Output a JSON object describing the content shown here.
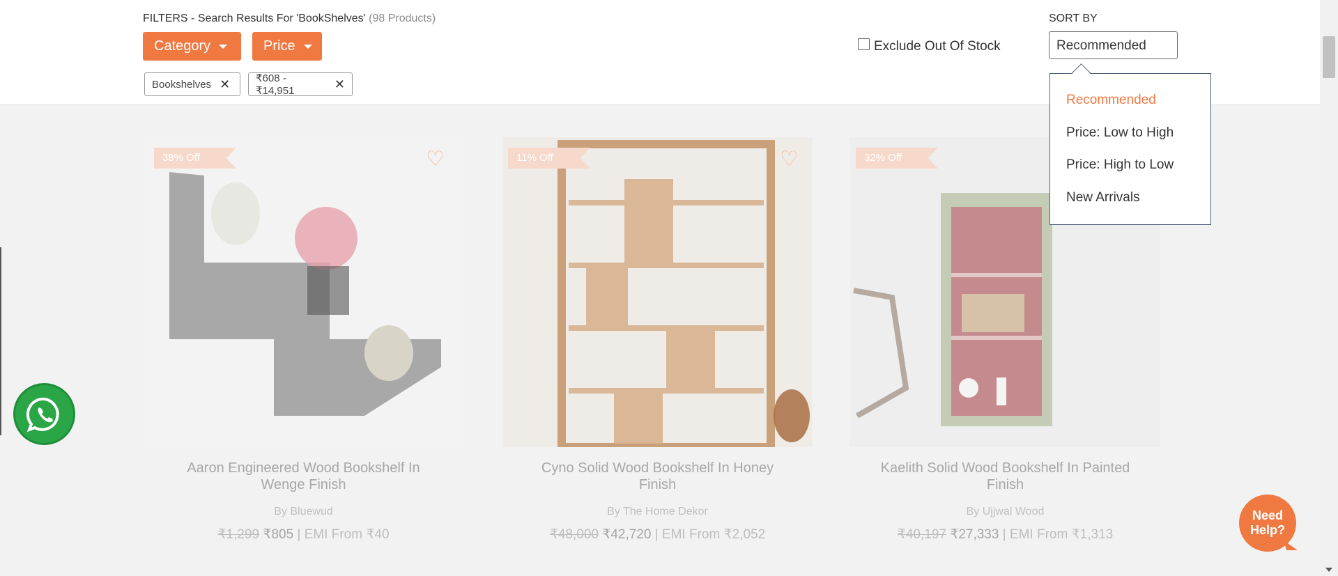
{
  "filters": {
    "title": "FILTERS - Search Results For 'BookShelves'",
    "count": "(98 Products)",
    "category_label": "Category",
    "price_label": "Price",
    "chips": [
      "Bookshelves",
      "₹608 - ₹14,951"
    ],
    "exclude_label": "Exclude Out Of Stock",
    "exclude_checked": false
  },
  "sort": {
    "label": "SORT BY",
    "selected": "Recommended",
    "options": [
      "Recommended",
      "Price: Low to High",
      "Price: High to Low",
      "New Arrivals"
    ]
  },
  "products": [
    {
      "badge": "38% Off",
      "name": "Aaron Engineered Wood Bookshelf In Wenge Finish",
      "brand": "By Bluewud",
      "mrp": "₹1,299",
      "price": "₹805",
      "emi": "| EMI From ₹40"
    },
    {
      "badge": "11% Off",
      "name": "Cyno Solid Wood Bookshelf In Honey Finish",
      "brand": "By The Home Dekor",
      "mrp": "₹48,000",
      "price": "₹42,720",
      "emi": "| EMI From ₹2,052"
    },
    {
      "badge": "32% Off",
      "name": "Kaelith Solid Wood Bookshelf In Painted Finish",
      "brand": "By Ujjwal Wood",
      "mrp": "₹40,197",
      "price": "₹27,333",
      "emi": "| EMI From ₹1,313"
    }
  ],
  "help": {
    "line1": "Need",
    "line2": "Help?"
  },
  "colors": {
    "accent": "#f07942",
    "whatsapp": "#2aa646"
  },
  "icons": [
    "caret-down-icon",
    "close-icon",
    "heart-icon",
    "whatsapp-icon",
    "help-bubble-icon"
  ]
}
